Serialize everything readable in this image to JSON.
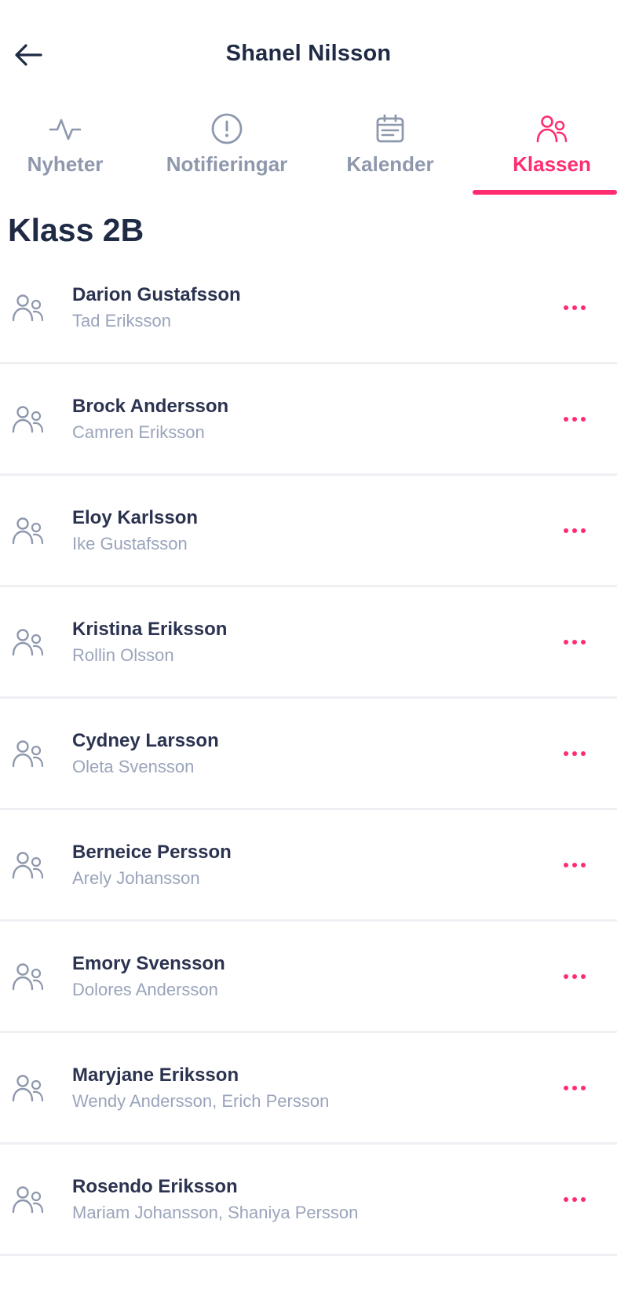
{
  "header": {
    "back_icon": "arrow-left-icon",
    "title": "Shanel Nilsson"
  },
  "tabs": [
    {
      "label": "Nyheter",
      "icon": "activity-pulse-icon",
      "active": false
    },
    {
      "label": "Notifieringar",
      "icon": "alert-circle-icon",
      "active": false
    },
    {
      "label": "Kalender",
      "icon": "calendar-icon",
      "active": false
    },
    {
      "label": "Klassen",
      "icon": "users-icon",
      "active": true
    }
  ],
  "section": {
    "title": "Klass 2B"
  },
  "students": [
    {
      "name": "Darion Gustafsson",
      "parents": "Tad Eriksson"
    },
    {
      "name": "Brock Andersson",
      "parents": "Camren Eriksson"
    },
    {
      "name": "Eloy Karlsson",
      "parents": "Ike Gustafsson"
    },
    {
      "name": "Kristina Eriksson",
      "parents": "Rollin Olsson"
    },
    {
      "name": "Cydney Larsson",
      "parents": "Oleta Svensson"
    },
    {
      "name": "Berneice Persson",
      "parents": "Arely Johansson"
    },
    {
      "name": "Emory Svensson",
      "parents": "Dolores Andersson"
    },
    {
      "name": "Maryjane Eriksson",
      "parents": "Wendy Andersson, Erich Persson"
    },
    {
      "name": "Rosendo Eriksson",
      "parents": "Mariam Johansson, Shaniya Persson"
    }
  ],
  "colors": {
    "accent": "#ff2d6f",
    "text_primary": "#1f2a44",
    "text_muted": "#8e98ad",
    "divider": "#eef0f4"
  }
}
